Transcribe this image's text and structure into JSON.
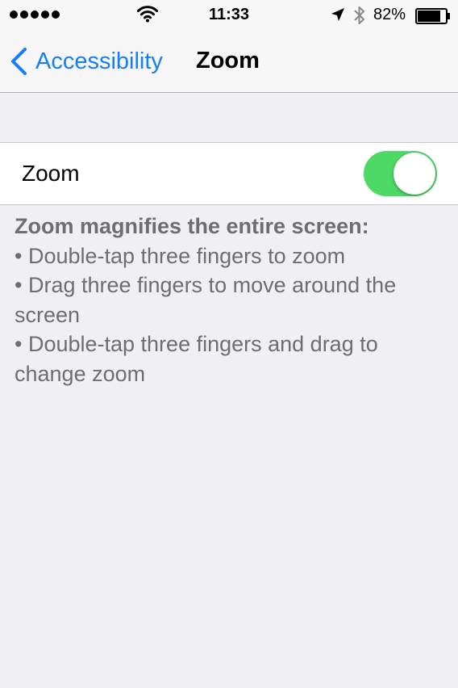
{
  "status_bar": {
    "time": "11:33",
    "battery_percent": "82%",
    "battery_level": 0.82,
    "signal_bars": 5,
    "icons": [
      "signal-dots-icon",
      "wifi-icon",
      "location-arrow-icon",
      "bluetooth-icon",
      "battery-icon"
    ]
  },
  "nav": {
    "back_label": "Accessibility",
    "title": "Zoom",
    "back_icon": "chevron-left-icon"
  },
  "zoom_row": {
    "label": "Zoom",
    "toggle_on": true
  },
  "footer": {
    "heading": "Zoom magnifies the entire screen:",
    "bullets": [
      "•  Double-tap three fingers to zoom",
      "•  Drag three fingers to move around the screen",
      "•  Double-tap three fingers and drag to change zoom"
    ]
  },
  "colors": {
    "accent": "#147efb",
    "toggle_on": "#4cd964",
    "background": "#efeff4",
    "footer_text": "#6d6d72"
  }
}
